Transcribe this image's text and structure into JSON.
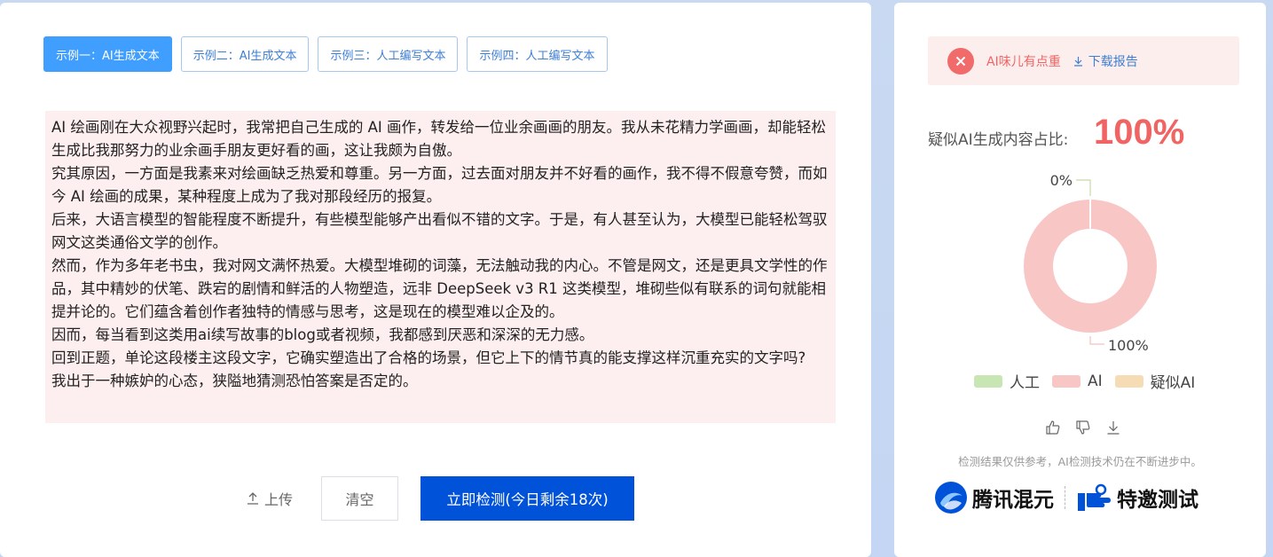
{
  "tabs": [
    {
      "label": "示例一：AI生成文本",
      "active": true
    },
    {
      "label": "示例二：AI生成文本",
      "active": false
    },
    {
      "label": "示例三：人工编写文本",
      "active": false
    },
    {
      "label": "示例四：人工编写文本",
      "active": false
    }
  ],
  "content": {
    "paragraphs": [
      "AI 绘画刚在大众视野兴起时，我常把自己生成的 AI 画作，转发给一位业余画画的朋友。我从未花精力学画画，却能轻松生成比我那努力的业余画手朋友更好看的画，这让我颇为自傲。",
      "究其原因，一方面是我素来对绘画缺乏热爱和尊重。另一方面，过去面对朋友并不好看的画作，我不得不假意夸赞，而如今 AI 绘画的成果，某种程度上成为了我对那段经历的报复。",
      "后来，大语言模型的智能程度不断提升，有些模型能够产出看似不错的文字。于是，有人甚至认为，大模型已能轻松驾驭网文这类通俗文学的创作。",
      "然而，作为多年老书虫，我对网文满怀热爱。大模型堆砌的词藻，无法触动我的内心。不管是网文，还是更具文学性的作品，其中精妙的伏笔、跌宕的剧情和鲜活的人物塑造，远非 DeepSeek v3 R1 这类模型，堆砌些似有联系的词句就能相提并论的。它们蕴含着创作者独特的情感与思考，这是现在的模型难以企及的。",
      "因而，每当看到这类用ai续写故事的blog或者视频，我都感到厌恶和深深的无力感。",
      "回到正题，单论这段楼主这段文字，它确实塑造出了合格的场景，但它上下的情节真的能支撑这样沉重充实的文字吗?",
      "我出于一种嫉妒的心态，狭隘地猜测恐怕答案是否定的。"
    ]
  },
  "actions": {
    "upload_label": "上传",
    "clear_label": "清空",
    "detect_label": "立即检测(今日剩余18次)"
  },
  "result": {
    "alert_text": "AI味儿有点重",
    "download_label": "下载报告",
    "ratio_label": "疑似AI生成内容占比:",
    "ratio_value": "100%",
    "disclaimer": "检测结果仅供参考，AI检测技术仍在不断进步中。"
  },
  "chart_data": {
    "type": "pie",
    "categories": [
      "人工",
      "AI",
      "疑似AI"
    ],
    "values": [
      0,
      100,
      0
    ],
    "colors": [
      "#c8e6b4",
      "#f9c6c6",
      "#f5dcb4"
    ],
    "data_labels": [
      "0%",
      "100%"
    ],
    "legend": "bottom",
    "donut": true
  },
  "brands": {
    "brand1": "腾讯混元",
    "brand2": "特邀测试"
  },
  "colors": {
    "primary": "#0052d9",
    "tab_active": "#409eff",
    "alert": "#f06464"
  }
}
